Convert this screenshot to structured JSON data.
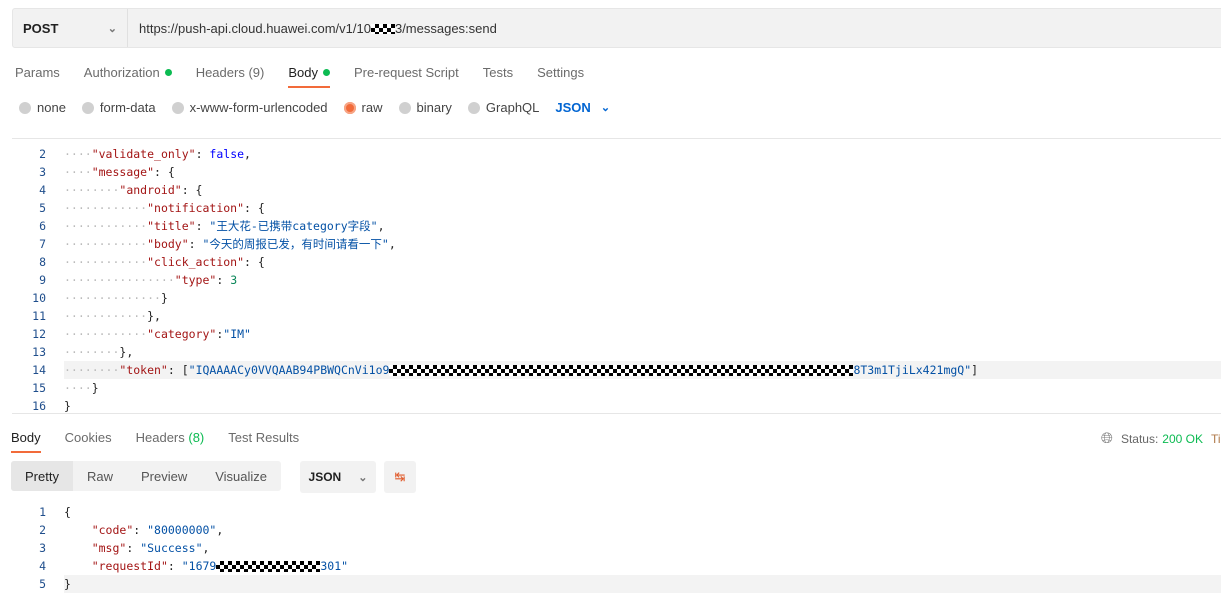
{
  "request": {
    "method": "POST",
    "url_prefix": "https://push-api.cloud.huawei.com/v1/10",
    "url_suffix": "3/messages:send"
  },
  "tabs": [
    {
      "label": "Params"
    },
    {
      "label": "Authorization",
      "dot": true
    },
    {
      "label": "Headers",
      "count": "(9)"
    },
    {
      "label": "Body",
      "dot": true,
      "active": true
    },
    {
      "label": "Pre-request Script"
    },
    {
      "label": "Tests"
    },
    {
      "label": "Settings"
    }
  ],
  "body_types": [
    {
      "label": "none"
    },
    {
      "label": "form-data"
    },
    {
      "label": "x-www-form-urlencoded"
    },
    {
      "label": "raw",
      "selected": true
    },
    {
      "label": "binary"
    },
    {
      "label": "GraphQL"
    }
  ],
  "body_format": "JSON",
  "request_body": [
    {
      "n": "2",
      "i": 1,
      "t": [
        [
          "k",
          "\"validate_only\""
        ],
        [
          "p",
          ": "
        ],
        [
          "b",
          "false"
        ],
        [
          "p",
          ","
        ]
      ]
    },
    {
      "n": "3",
      "i": 1,
      "t": [
        [
          "k",
          "\"message\""
        ],
        [
          "p",
          ": {"
        ]
      ]
    },
    {
      "n": "4",
      "i": 2,
      "t": [
        [
          "k",
          "\"android\""
        ],
        [
          "p",
          ": {"
        ]
      ]
    },
    {
      "n": "5",
      "i": 3,
      "t": [
        [
          "k",
          "\"notification\""
        ],
        [
          "p",
          ": {"
        ]
      ]
    },
    {
      "n": "6",
      "i": 3,
      "t": [
        [
          "k",
          "\"title\""
        ],
        [
          "p",
          ": "
        ],
        [
          "s",
          "\"王大花-已携带category字段\""
        ],
        [
          "p",
          ","
        ]
      ]
    },
    {
      "n": "7",
      "i": 3,
      "t": [
        [
          "k",
          "\"body\""
        ],
        [
          "p",
          ": "
        ],
        [
          "s",
          "\"今天的周报已发，有时间请看一下\""
        ],
        [
          "p",
          ","
        ]
      ]
    },
    {
      "n": "8",
      "i": 3,
      "t": [
        [
          "k",
          "\"click_action\""
        ],
        [
          "p",
          ": {"
        ]
      ]
    },
    {
      "n": "9",
      "i": 4,
      "t": [
        [
          "k",
          "\"type\""
        ],
        [
          "p",
          ": "
        ],
        [
          "n",
          "3"
        ]
      ]
    },
    {
      "n": "10",
      "i": 3.5,
      "t": [
        [
          "p",
          "}"
        ]
      ]
    },
    {
      "n": "11",
      "i": 3,
      "t": [
        [
          "p",
          "},"
        ]
      ]
    },
    {
      "n": "12",
      "i": 3,
      "t": [
        [
          "k",
          "\"category\""
        ],
        [
          "p",
          ":"
        ],
        [
          "s",
          "\"IM\""
        ]
      ]
    },
    {
      "n": "13",
      "i": 2,
      "t": [
        [
          "p",
          "},"
        ]
      ]
    },
    {
      "n": "14",
      "i": 2,
      "hl": true,
      "t": [
        [
          "k",
          "\"token\""
        ],
        [
          "p",
          ": ["
        ],
        [
          "s",
          "\"IQAAAACy0VVQAAB94PBWQCnVi1o9"
        ],
        [
          "x",
          ""
        ],
        [
          "s",
          "8T3m1TjiLx421mgQ\""
        ],
        [
          "p",
          "]"
        ]
      ]
    },
    {
      "n": "15",
      "i": 1,
      "t": [
        [
          "p",
          "}"
        ]
      ]
    },
    {
      "n": "16",
      "i": 0,
      "t": [
        [
          "p",
          "}"
        ]
      ]
    }
  ],
  "response_tabs": [
    {
      "label": "Body",
      "active": true
    },
    {
      "label": "Cookies"
    },
    {
      "label": "Headers",
      "count": "(8)"
    },
    {
      "label": "Test Results"
    }
  ],
  "status": {
    "label": "Status:",
    "value": "200 OK",
    "extra": "Ti"
  },
  "view_modes": [
    "Pretty",
    "Raw",
    "Preview",
    "Visualize"
  ],
  "response_format": "JSON",
  "response_body": [
    {
      "n": "1",
      "i": 0,
      "t": [
        [
          "p",
          "{"
        ]
      ]
    },
    {
      "n": "2",
      "i": 1,
      "t": [
        [
          "k",
          "\"code\""
        ],
        [
          "p",
          ": "
        ],
        [
          "s",
          "\"80000000\""
        ],
        [
          "p",
          ","
        ]
      ]
    },
    {
      "n": "3",
      "i": 1,
      "t": [
        [
          "k",
          "\"msg\""
        ],
        [
          "p",
          ": "
        ],
        [
          "s",
          "\"Success\""
        ],
        [
          "p",
          ","
        ]
      ]
    },
    {
      "n": "4",
      "i": 1,
      "t": [
        [
          "k",
          "\"requestId\""
        ],
        [
          "p",
          ": "
        ],
        [
          "s",
          "\"1679"
        ],
        [
          "x",
          ""
        ],
        [
          "s",
          "301\""
        ]
      ]
    },
    {
      "n": "5",
      "i": 0,
      "hl": true,
      "t": [
        [
          "p",
          "}"
        ]
      ]
    }
  ]
}
